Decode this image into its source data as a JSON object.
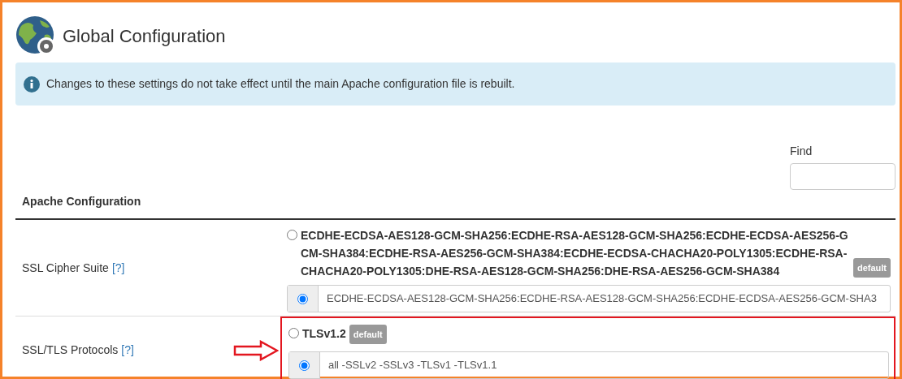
{
  "header": {
    "title": "Global Configuration"
  },
  "alert": {
    "text": "Changes to these settings do not take effect until the main Apache configuration file is rebuilt."
  },
  "find": {
    "label": "Find"
  },
  "table": {
    "heading": "Apache Configuration",
    "rows": [
      {
        "label": "SSL Cipher Suite",
        "help": "[?]",
        "highlighted": false,
        "default_option": {
          "value": "ECDHE-ECDSA-AES128-GCM-SHA256:ECDHE-RSA-AES128-GCM-SHA256:ECDHE-ECDSA-AES256-GCM-SHA384:ECDHE-RSA-AES256-GCM-SHA384:ECDHE-ECDSA-CHACHA20-POLY1305:ECDHE-RSA-CHACHA20-POLY1305:DHE-RSA-AES128-GCM-SHA256:DHE-RSA-AES256-GCM-SHA384",
          "badge": "default",
          "selected": false
        },
        "custom_option": {
          "value": "ECDHE-ECDSA-AES128-GCM-SHA256:ECDHE-RSA-AES128-GCM-SHA256:ECDHE-ECDSA-AES256-GCM-SHA3",
          "selected": true
        }
      },
      {
        "label": "SSL/TLS Protocols",
        "help": "[?]",
        "highlighted": true,
        "default_option": {
          "value": "TLSv1.2",
          "badge": "default",
          "selected": false
        },
        "custom_option": {
          "value": "all -SSLv2 -SSLv3 -TLSv1 -TLSv1.1",
          "selected": true
        }
      }
    ]
  }
}
